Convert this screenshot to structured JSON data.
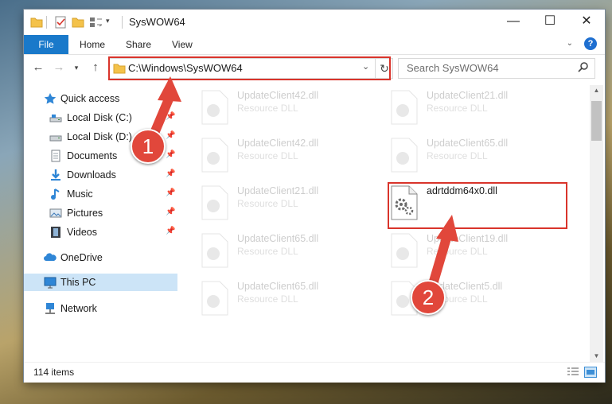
{
  "window": {
    "title": "SysWOW64",
    "controls": {
      "minimize": "—",
      "maximize": "☐",
      "close": "✕"
    }
  },
  "ribbon": {
    "tabs": [
      "File",
      "Home",
      "Share",
      "View"
    ],
    "help": "?"
  },
  "address": {
    "path": "C:\\Windows\\SysWOW64",
    "search_placeholder": "Search SysWOW64"
  },
  "nav_pane": {
    "items": [
      {
        "label": "Quick access",
        "icon": "star-icon"
      },
      {
        "label": "Local Disk (C:)",
        "icon": "drive-icon",
        "pinned": true
      },
      {
        "label": "Local Disk (D:)",
        "icon": "drive-icon",
        "pinned": true
      },
      {
        "label": "Documents",
        "icon": "documents-icon",
        "pinned": true
      },
      {
        "label": "Downloads",
        "icon": "download-icon",
        "pinned": true
      },
      {
        "label": "Music",
        "icon": "music-icon",
        "pinned": true
      },
      {
        "label": "Pictures",
        "icon": "pictures-icon",
        "pinned": true
      },
      {
        "label": "Videos",
        "icon": "videos-icon",
        "pinned": true
      },
      {
        "label": "OneDrive",
        "icon": "cloud-icon"
      },
      {
        "label": "This PC",
        "icon": "computer-icon",
        "selected": true
      },
      {
        "label": "Network",
        "icon": "network-icon"
      }
    ]
  },
  "files": {
    "left": [
      {
        "name": "UpdateClient42.dll",
        "type": "Resource DLL"
      },
      {
        "name": "UpdateClient42.dll",
        "type": "Resource DLL"
      },
      {
        "name": "UpdateClient21.dll",
        "type": "Resource DLL"
      },
      {
        "name": "UpdateClient65.dll",
        "type": "Resource DLL"
      },
      {
        "name": "UpdateClient65.dll",
        "type": "Resource DLL"
      }
    ],
    "right": [
      {
        "name": "UpdateClient21.dll",
        "type": "Resource DLL"
      },
      {
        "name": "UpdateClient65.dll",
        "type": "Resource DLL"
      },
      {
        "name": "adrtddm64x0.dll",
        "type": "",
        "highlighted": true
      },
      {
        "name": "UpdateClient19.dll",
        "type": "Resource DLL"
      },
      {
        "name": "UpdateClient5.dll",
        "type": "Resource DLL"
      }
    ]
  },
  "status": {
    "item_count": "114 items"
  },
  "annotations": {
    "step1": "1",
    "step2": "2"
  },
  "colors": {
    "accent": "#1979ca",
    "annotation_red": "#d9342b",
    "selected_bg": "#cce4f7"
  }
}
